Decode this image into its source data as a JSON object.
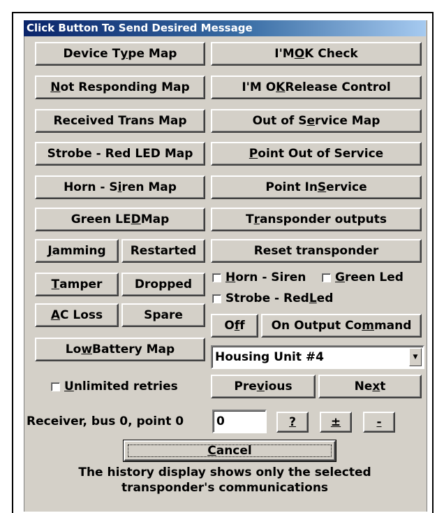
{
  "title": "Click Button To Send Desired Message",
  "left_buttons": {
    "device_type_map": [
      "Device T",
      "y",
      "pe Map"
    ],
    "not_responding_map": [
      "",
      "N",
      "ot Responding Map"
    ],
    "received_trans_map": [
      "Received Trans Map",
      "",
      ""
    ],
    "strobe_red_led_map": [
      "Strobe - Red LED Map",
      "",
      ""
    ],
    "horn_siren_map": [
      "Horn - S",
      "i",
      "ren Map"
    ],
    "green_led_map": [
      "Green LE",
      "D",
      " Map"
    ],
    "jamming": [
      "",
      "J",
      "amming"
    ],
    "restarted": [
      "Restarted",
      "",
      ""
    ],
    "tamper": [
      "",
      "T",
      "amper"
    ],
    "dropped": [
      "Dropped",
      "",
      ""
    ],
    "ac_loss": [
      "",
      "A",
      "C Loss"
    ],
    "spare": [
      "Spare",
      "",
      ""
    ],
    "low_battery_map": [
      "Lo",
      "w",
      " Battery Map"
    ]
  },
  "right_buttons": {
    "im_ok_check": [
      "I'M ",
      "O",
      "K Check"
    ],
    "im_ok_release": [
      "I'M O",
      "K",
      " Release Control"
    ],
    "out_of_service_map": [
      "Out of S",
      "e",
      "rvice Map"
    ],
    "point_out_of_service": [
      "",
      "P",
      "oint Out of Service"
    ],
    "point_in_service": [
      "Point In ",
      "S",
      "ervice"
    ],
    "transponder_outputs": [
      "T",
      "r",
      "ansponder outputs"
    ],
    "reset_transponder": [
      "Reset transponder",
      "",
      ""
    ],
    "off": [
      "O",
      "f",
      "f"
    ],
    "on_output_command": [
      "On Output Co",
      "m",
      "mand"
    ],
    "previous": [
      "Pre",
      "v",
      "ious"
    ],
    "next": [
      "Ne",
      "x",
      "t"
    ]
  },
  "checkboxes": {
    "horn_siren": [
      "",
      "H",
      "orn - Siren"
    ],
    "green_led": [
      "",
      "G",
      "reen Led"
    ],
    "strobe_red_led": [
      "Strobe - Red ",
      "L",
      "ed"
    ],
    "unlimited_retries": [
      "",
      "U",
      "nlimited retries"
    ]
  },
  "housing_select": {
    "value": "Housing Unit #4"
  },
  "receiver_label": "Receiver, bus 0, point 0",
  "point_input": {
    "value": "0"
  },
  "small_buttons": {
    "help": "?",
    "plus_minus": "±",
    "minus": "-"
  },
  "cancel_button": [
    "",
    "C",
    "ancel"
  ],
  "note_lines": [
    "The history display shows only the selected",
    "transponder's communications"
  ]
}
